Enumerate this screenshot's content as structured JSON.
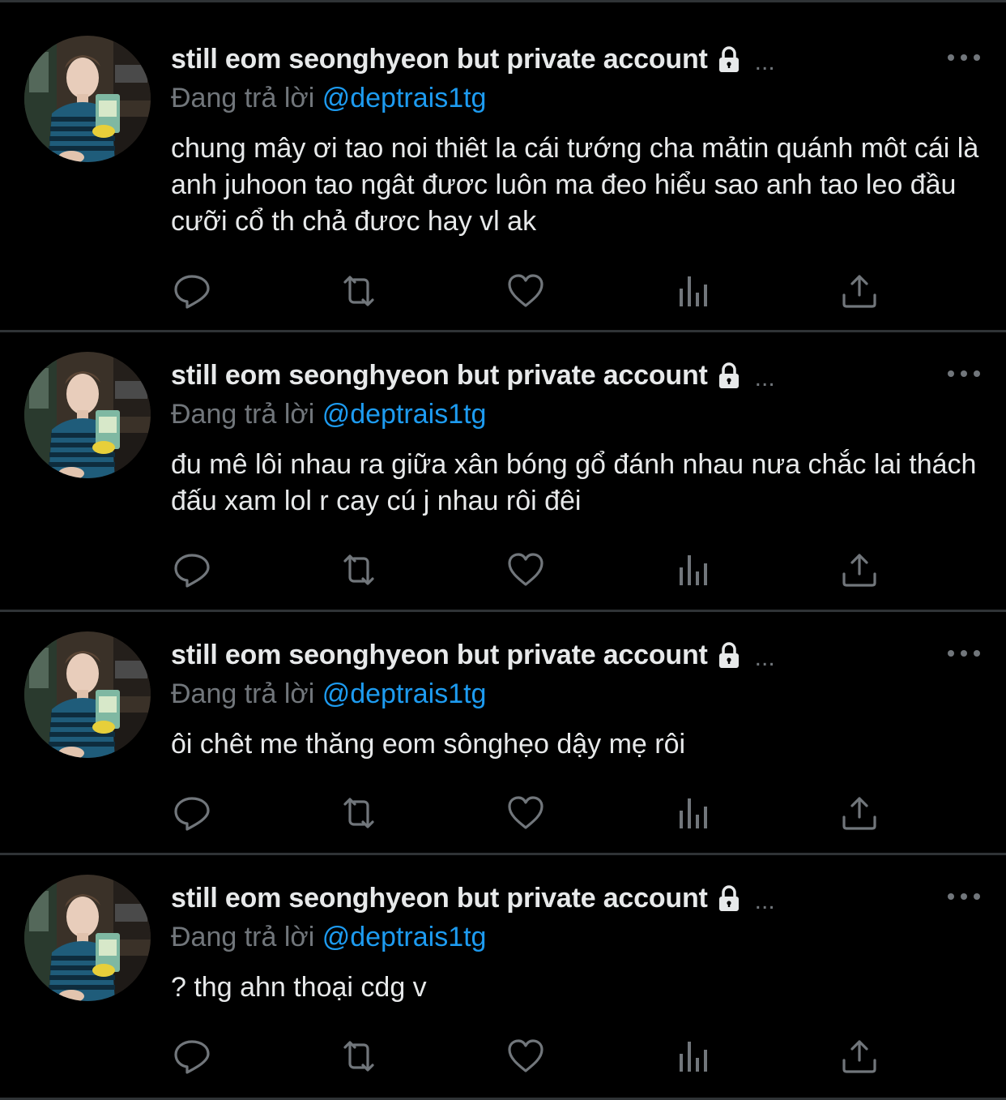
{
  "colors": {
    "background": "#000000",
    "divider": "#2f3336",
    "text_primary": "#e7e9ea",
    "text_secondary": "#71767b",
    "accent": "#1d9bf0"
  },
  "tweets": [
    {
      "author": {
        "display_name": "still eom seonghyeon but private account",
        "avatar_icon": "profile-avatar",
        "lock_icon": "lock-icon",
        "truncation": "..."
      },
      "reply_prefix": "Đang trả lời",
      "reply_handle": "@deptrais1tg",
      "text": "chung mây ơi tao noi thiêt la cái tướng cha mảtin quánh môt cái là anh juhoon tao ngât đươc luôn ma đeo hiểu sao anh tao leo đầu cưỡi cổ th chả đươc hay vl ak",
      "actions": [
        "reply-icon",
        "retweet-icon",
        "like-icon",
        "views-icon",
        "share-icon"
      ]
    },
    {
      "author": {
        "display_name": "still eom seonghyeon but private account",
        "avatar_icon": "profile-avatar",
        "lock_icon": "lock-icon",
        "truncation": "..."
      },
      "reply_prefix": "Đang trả lời",
      "reply_handle": "@deptrais1tg",
      "text": "đu mê lôi nhau ra giữa xân bóng gổ đánh nhau nưa chắc lai thách đấu xam lol r cay cú j nhau rôi đêi",
      "actions": [
        "reply-icon",
        "retweet-icon",
        "like-icon",
        "views-icon",
        "share-icon"
      ]
    },
    {
      "author": {
        "display_name": "still eom seonghyeon but private account",
        "avatar_icon": "profile-avatar",
        "lock_icon": "lock-icon",
        "truncation": "..."
      },
      "reply_prefix": "Đang trả lời",
      "reply_handle": "@deptrais1tg",
      "text": "ôi chêt me thăng eom sônghẹo dậy mẹ rôi",
      "actions": [
        "reply-icon",
        "retweet-icon",
        "like-icon",
        "views-icon",
        "share-icon"
      ]
    },
    {
      "author": {
        "display_name": "still eom seonghyeon but private account",
        "avatar_icon": "profile-avatar",
        "lock_icon": "lock-icon",
        "truncation": "..."
      },
      "reply_prefix": "Đang trả lời",
      "reply_handle": "@deptrais1tg",
      "text": "? thg ahn thoại cdg v",
      "actions": [
        "reply-icon",
        "retweet-icon",
        "like-icon",
        "views-icon",
        "share-icon"
      ]
    }
  ]
}
